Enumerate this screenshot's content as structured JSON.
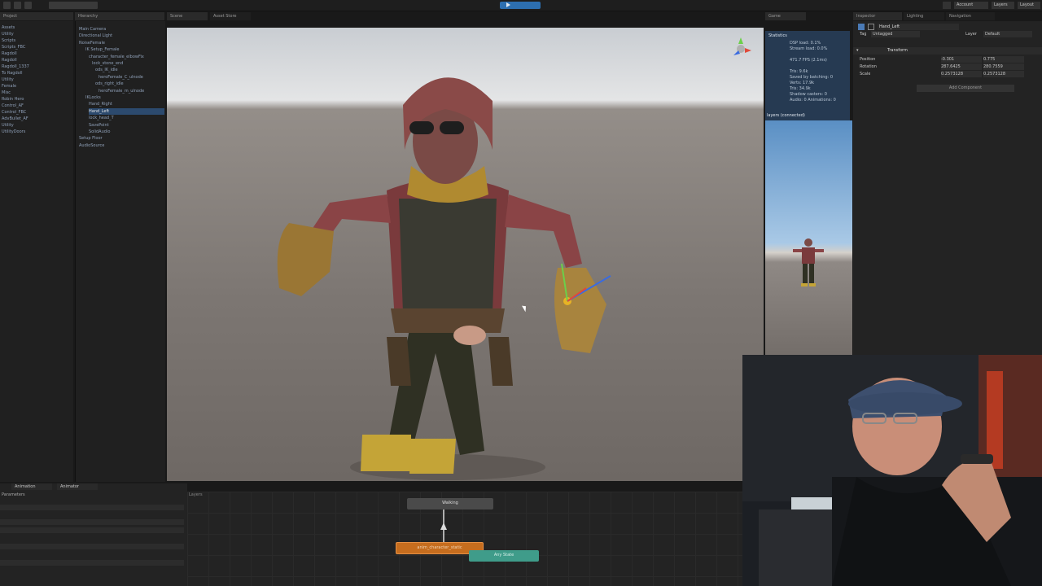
{
  "toolbar": {
    "account_label": "Account",
    "layers_label": "Layers",
    "layout_label": "Layout"
  },
  "tabs": {
    "project": "Project",
    "hierarchy": "Hierarchy",
    "scene": "Scene",
    "asset_store": "Asset Store",
    "game": "Game",
    "inspector": "Inspector",
    "lighting": "Lighting",
    "navigation": "Navigation",
    "animation": "Animation",
    "animator": "Animator"
  },
  "project": {
    "items": [
      "Assets",
      "Utility",
      "Scripts",
      "Scripts_FBC",
      "Ragdoll",
      "Ragdoll",
      "Ragdoll_1337",
      "To Ragdoll",
      "Utility",
      "Female",
      "Misc",
      "Robin Hero",
      "Control_AF",
      "Control_FBC",
      "AdvBullet_AF",
      "Utility",
      "UtilityDoors"
    ]
  },
  "hierarchy": {
    "items": [
      "Main Camera",
      "Directional Light",
      "NoiseFemale",
      "IK Setup_Female",
      "character_female_elbowFix",
      "lock_stone_end",
      "ods_IK_idle",
      "heroFemale_C_ulnode",
      "ods_right_idle",
      "heroFemale_m_ulnode",
      "IKLocks",
      "Hand_Right",
      "Hand_Left",
      "lock_head_T",
      "SavePoint",
      "SolidAudio",
      "Setup Floor",
      "AudioSource"
    ],
    "selected_index": 12
  },
  "stats": {
    "title": "Statistics",
    "lines": [
      "DSP load: 0.1%",
      "Stream load: 0.0%",
      "",
      "471.7 FPS (2.1ms)",
      "",
      "Tris: 9.6k",
      "Saved by batching: 0",
      "Verts: 17.9k",
      "Tris: 34.9k",
      "Shadow casters: 0",
      "Audio: 0  Animations: 0"
    ],
    "footer": "layers (connected)"
  },
  "inspector": {
    "object_name": "Hand_Left",
    "tag_label": "Tag",
    "tag_value": "Untagged",
    "layer_label": "Layer",
    "layer_value": "Default",
    "transform_title": "Transform",
    "position_label": "Position",
    "rotation_label": "Rotation",
    "scale_label": "Scale",
    "position_x": "-0.301",
    "position_y": "0.775",
    "rotation_x": "287.6425",
    "rotation_y": "280.7559",
    "scale_x": "0.2573128",
    "scale_y": "0.2573128",
    "add_component": "Add Component"
  },
  "animator": {
    "layer_tab": "Layers",
    "state_walking": "Walking",
    "state_default": "anim_character_static",
    "state_any": "Any State",
    "colors": {
      "default_state": "#c66d1e",
      "any_state": "#3f9c8a",
      "plain_state": "#4a4a4a"
    }
  },
  "params": {
    "tab": "Parameters"
  }
}
